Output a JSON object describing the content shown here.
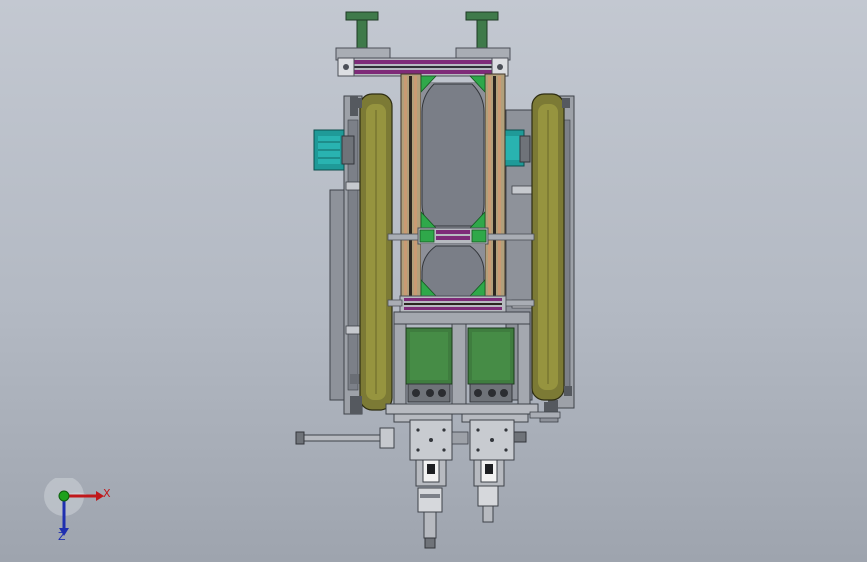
{
  "viewport": {
    "background_top": "#c3c8d1",
    "background_bottom": "#9ea4ae"
  },
  "triad": {
    "x_label": "X",
    "z_label": "Z",
    "x_color": "#c0181b",
    "y_color": "#1da11d",
    "z_color": "#1f2fb0"
  },
  "colors": {
    "frame_grey": "#8e929a",
    "frame_dark": "#4b4f57",
    "belt_olive": "#7c7a35",
    "belt_olive_light": "#96943f",
    "motor_teal": "#1f9a98",
    "motor_green": "#3f7d3f",
    "plate_green": "#2fa84a",
    "rail_purple": "#7e2b78",
    "rail_orange": "#c99a73",
    "handle_green": "#3f7a4a"
  }
}
